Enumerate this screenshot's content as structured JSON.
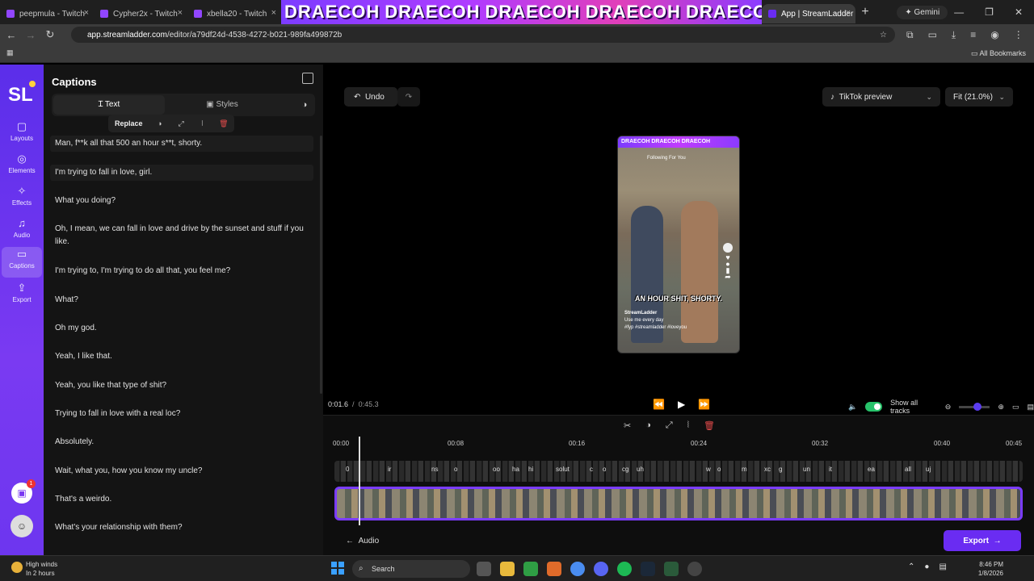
{
  "browser": {
    "tabs": [
      "peepmula - Twitch",
      "Cypher2x - Twitch",
      "xbella20 - Twitch"
    ],
    "banner": [
      "DRAECOH",
      "DRAECOH",
      "DRAECOH",
      "DRAECOH",
      "DRAECOH"
    ],
    "active_tab": "App | StreamLadder",
    "gemini": "Gemini",
    "url_site": "app.streamladder.com",
    "url_path": "/editor/a79df24d-4538-4272-b021-989fa499872b",
    "all_bookmarks": "All Bookmarks"
  },
  "rail": {
    "logo": "SL",
    "items": [
      "Layouts",
      "Elements",
      "Effects",
      "Audio",
      "Captions",
      "Export"
    ],
    "notif_count": "1"
  },
  "panel": {
    "title": "Captions",
    "tab_text": "Text",
    "tab_styles": "Styles",
    "replace": "Replace",
    "captions": [
      "Man, f**k all that 500 an hour s**t, shorty.",
      "I'm trying to fall in love, girl.",
      "What you doing?",
      "Oh, I mean, we can fall in love and drive by the sunset and stuff if you like.",
      "I'm trying to, I'm trying to do all that, you feel me?",
      "What?",
      "Oh my god.",
      "Yeah, I like that.",
      "Yeah, you like that type of shit?",
      "Trying to fall in love with a real loc?",
      "Absolutely.",
      "Wait, what you, how you know my uncle?",
      "That's a weirdo.",
      "What's your relationship with them?"
    ]
  },
  "stage": {
    "undo": "Undo",
    "preview_mode": "TikTok preview",
    "fit": "Fit (21.0%)",
    "phone_caption": "AN HOUR SHIT, SHORTY.",
    "phone_user": "StreamLadder",
    "phone_desc": "Use me every day",
    "phone_tags": "#fyp #streamladder #loveyou",
    "phone_tabs": "Following   For You"
  },
  "transport": {
    "current": "0:01.6",
    "separator": "/",
    "total": "0:45.3",
    "show_all_tracks": "Show all tracks"
  },
  "timeline": {
    "ruler": [
      "00:00",
      "00:08",
      "00:16",
      "00:24",
      "00:32",
      "00:40",
      "00:45"
    ],
    "caption_words": [
      "0",
      "ir",
      "ns",
      "o",
      "oo",
      "ha",
      "hi",
      "solut",
      "c",
      "o",
      "cg",
      "uh",
      "w",
      "o",
      "m",
      "xc",
      "g",
      "un",
      "it",
      "ea",
      "all",
      "uj"
    ],
    "audio_label": "Audio",
    "export_label": "Export"
  },
  "taskbar": {
    "weather_title": "High winds",
    "weather_sub": "In 2 hours",
    "search": "Search",
    "time": "8:46 PM",
    "date": "1/8/2026"
  }
}
